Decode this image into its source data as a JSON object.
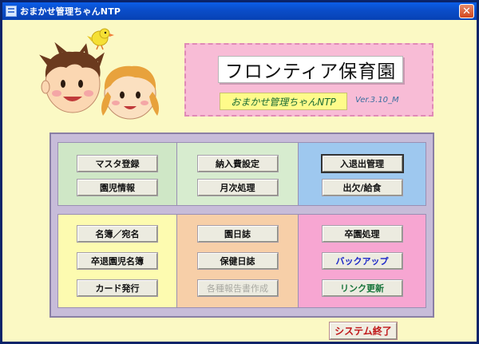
{
  "window": {
    "title": "おまかせ管理ちゃんNTP",
    "close_glyph": "✕"
  },
  "header": {
    "title": "フロンティア保育園",
    "subtitle": "おまかせ管理ちゃんNTP",
    "version": "Ver.3.10_M"
  },
  "menu": {
    "row1": {
      "panel1": [
        "マスタ登録",
        "園児情報"
      ],
      "panel2": [
        "納入費設定",
        "月次処理"
      ],
      "panel3": [
        "入退出管理",
        "出欠/給食"
      ]
    },
    "row2": {
      "panel1": [
        "名簿／宛名",
        "卒退園児名簿",
        "カード発行"
      ],
      "panel2": [
        "園日誌",
        "保健日誌",
        "各種報告書作成"
      ],
      "panel3": [
        "卒園処理",
        "バックアップ",
        "リンク更新"
      ]
    }
  },
  "footer": {
    "exit_label": "システム終了"
  },
  "colors": {
    "titlebar": "#0a4ecb",
    "background": "#fbf9c4",
    "header_plate": "#f8bcd6",
    "exit_text": "#c0181a",
    "backup_text": "#1a25c8",
    "link_text": "#16743a"
  },
  "icons": {
    "title": "app-icon",
    "close": "close-icon",
    "illustration": "kids-with-bird-illustration"
  }
}
